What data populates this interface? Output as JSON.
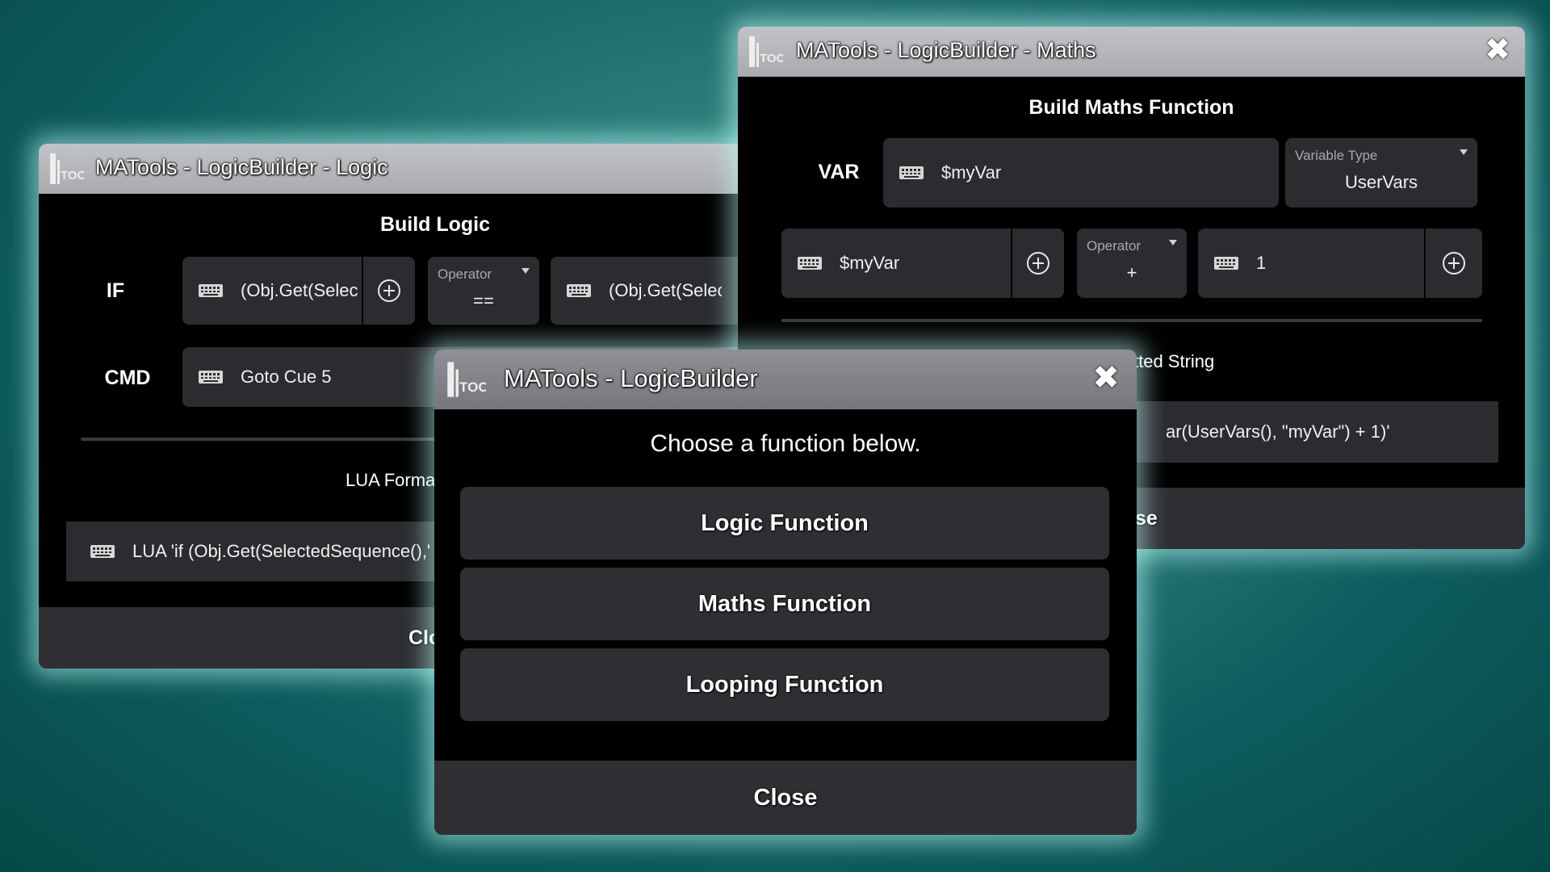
{
  "logic_window": {
    "title": "MATools - LogicBuilder - Logic",
    "heading": "Build Logic",
    "if_label": "IF",
    "if_left_value": "(Obj.Get(Selec",
    "operator_label": "Operator",
    "operator_value": "==",
    "if_right_value": "(Obj.Get(Selec",
    "cmd_label": "CMD",
    "cmd_value": "Goto Cue 5",
    "lua_format_label": "LUA Forma",
    "lua_value": "LUA 'if (Obj.Get(SelectedSequence(),'",
    "close_label": "Clo"
  },
  "maths_window": {
    "title": "MATools - LogicBuilder - Maths",
    "heading": "Build Maths Function",
    "var_label": "VAR",
    "var_value": "$myVar",
    "variable_type_label": "Variable Type",
    "variable_type_value": "UserVars",
    "left_operand": "$myVar",
    "operator_label": "Operator",
    "operator_value": "+",
    "right_operand": "1",
    "formatted_string_label": "tted String",
    "formatted_string_value": "ar(UserVars(), \"myVar\") + 1)'",
    "close_label": "se"
  },
  "main_window": {
    "title": "MATools - LogicBuilder",
    "prompt": "Choose a function below.",
    "buttons": [
      {
        "label": "Logic Function"
      },
      {
        "label": "Maths Function"
      },
      {
        "label": "Looping Function"
      }
    ],
    "close_label": "Close"
  },
  "icons": {
    "logo": "matools-logo-icon",
    "close": "close-x-icon",
    "keyboard": "keyboard-icon",
    "add": "plus-circle-icon"
  },
  "colors": {
    "background": "#0e5d5e",
    "window_bg": "#000000",
    "titlebar": "#b4b5b9",
    "field_bg": "#2c2c30",
    "glow": "#bef0ec"
  }
}
